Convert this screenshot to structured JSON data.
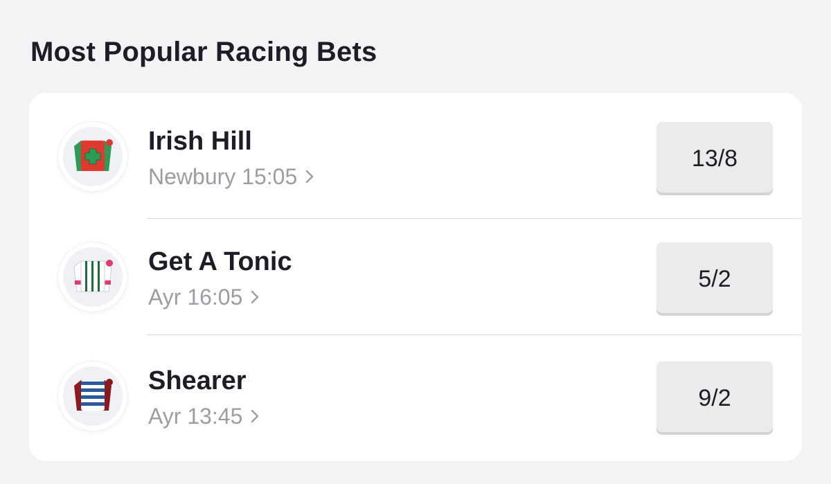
{
  "header": {
    "title": "Most Popular Racing Bets"
  },
  "bets": [
    {
      "runner": "Irish Hill",
      "race": "Newbury 15:05",
      "odds": "13/8",
      "silk_icon": "silk-red-green-cross-icon"
    },
    {
      "runner": "Get A Tonic",
      "race": "Ayr 16:05",
      "odds": "5/2",
      "silk_icon": "silk-white-green-stripes-icon"
    },
    {
      "runner": "Shearer",
      "race": "Ayr 13:45",
      "odds": "9/2",
      "silk_icon": "silk-blue-white-hoops-icon"
    }
  ],
  "colors": {
    "background": "#f2f3f5",
    "card": "#ffffff",
    "text_primary": "#1c1d26",
    "text_secondary": "#9c9ca4",
    "odds_button": "#ebebeb"
  }
}
